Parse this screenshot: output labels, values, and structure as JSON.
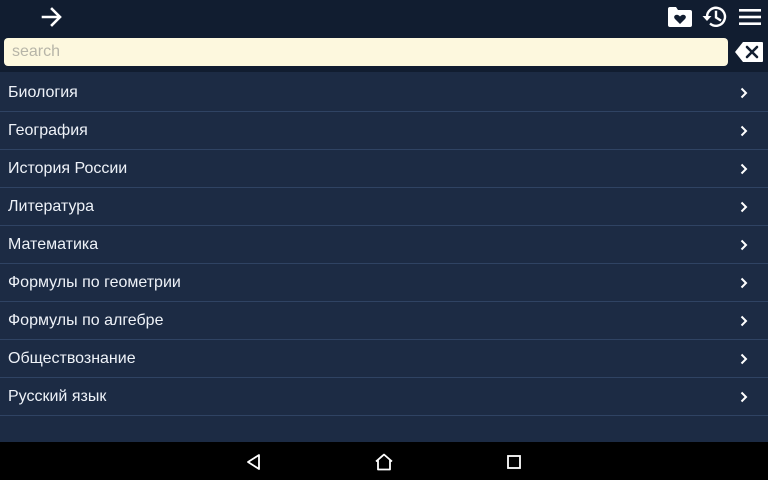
{
  "topbar": {
    "back_icon": "arrow-right-icon",
    "favorites_icon": "folder-heart-icon",
    "history_icon": "history-icon",
    "menu_icon": "hamburger-menu-icon"
  },
  "search": {
    "placeholder": "search",
    "value": "",
    "clear_icon": "backspace-clear-icon"
  },
  "list": {
    "items": [
      {
        "label": "Биология"
      },
      {
        "label": "География"
      },
      {
        "label": "История России"
      },
      {
        "label": "Литература"
      },
      {
        "label": "Математика"
      },
      {
        "label": "Формулы по геометрии"
      },
      {
        "label": "Формулы по алгебре"
      },
      {
        "label": "Обществознание"
      },
      {
        "label": "Русский язык"
      }
    ]
  },
  "navbar": {
    "back_icon": "nav-back-icon",
    "home_icon": "nav-home-icon",
    "recents_icon": "nav-recents-icon"
  },
  "colors": {
    "background": "#1c2b44",
    "bar": "#111d30",
    "search_bg": "#fdf8de",
    "text": "#eef2f8",
    "divider": "#2f4363"
  }
}
